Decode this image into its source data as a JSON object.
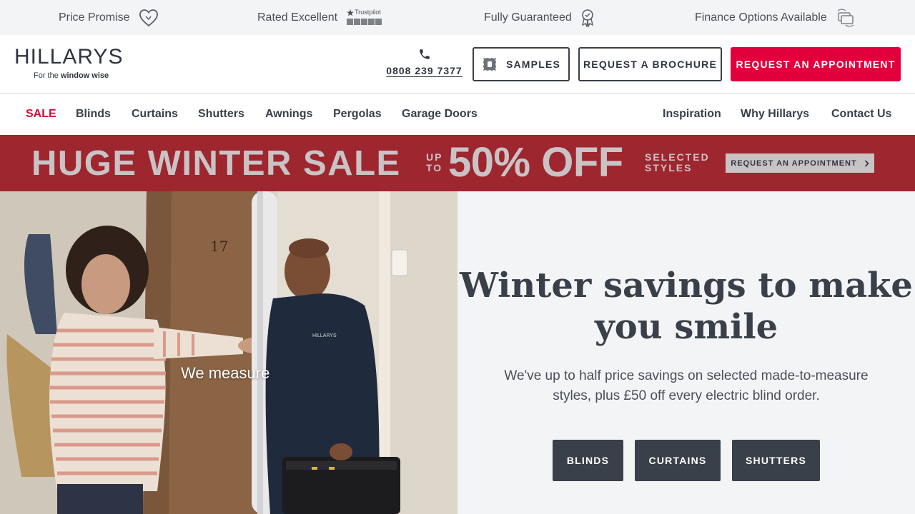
{
  "usp_bar": {
    "items": [
      {
        "label": "Price Promise",
        "icon": "heart-icon"
      },
      {
        "label": "Rated Excellent",
        "icon": "trustpilot-logo",
        "badge": "Trustpilot"
      },
      {
        "label": "Fully Guaranteed",
        "icon": "award-ribbon-icon"
      },
      {
        "label": "Finance Options Available",
        "icon": "card-exchange-icon"
      }
    ]
  },
  "header": {
    "logo": {
      "wordmark": "HILLARYS",
      "tagline_prefix": "For the ",
      "tagline_bold": "window wise"
    },
    "phone": {
      "number": "0808 239 7377",
      "icon": "phone-icon"
    },
    "samples_label": "SAMPLES",
    "brochure_label": "REQUEST A BROCHURE",
    "appointment_label": "REQUEST AN APPOINTMENT"
  },
  "nav": {
    "left": [
      "SALE",
      "Blinds",
      "Curtains",
      "Shutters",
      "Awnings",
      "Pergolas",
      "Garage Doors"
    ],
    "right": [
      "Inspiration",
      "Why Hillarys",
      "Contact Us"
    ]
  },
  "sale_banner": {
    "title": "HUGE WINTER SALE",
    "up_to": "UP TO",
    "discount": "50% OFF",
    "selected": "SELECTED STYLES",
    "button": "REQUEST AN APPOINTMENT"
  },
  "hero": {
    "image_caption": "We measure",
    "uniform_logo": "HILLARYS",
    "door_number": "17",
    "heading": "Winter savings to make you smile",
    "subtext": "We've up to half price savings on selected made-to-measure styles, plus £50 off every electric blind order.",
    "buttons": [
      "BLINDS",
      "CURTAINS",
      "SHUTTERS"
    ]
  },
  "colors": {
    "accent_red": "#e2003c",
    "banner_red": "#9e262f",
    "dark_slate": "#3a4049",
    "light_bg": "#f3f4f6"
  }
}
